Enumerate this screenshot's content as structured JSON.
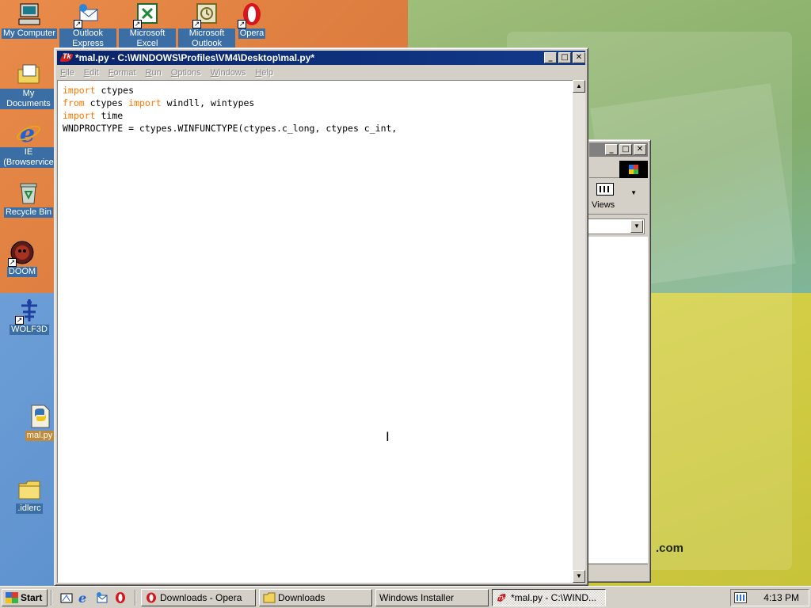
{
  "desktop": {
    "wallpaper_brand": ".com",
    "icons": [
      {
        "label": "My Computer",
        "icon": "computer-icon"
      },
      {
        "label": "Outlook Express",
        "icon": "outlook-express-icon"
      },
      {
        "label": "Microsoft Excel",
        "icon": "excel-icon"
      },
      {
        "label": "Microsoft Outlook",
        "icon": "outlook-icon"
      },
      {
        "label": "Opera",
        "icon": "opera-icon"
      },
      {
        "label": "My Documents",
        "icon": "documents-folder-icon"
      },
      {
        "label": "IE (Browservice",
        "icon": "internet-explorer-icon"
      },
      {
        "label": "Recycle Bin",
        "icon": "recycle-bin-icon"
      },
      {
        "label": "DOOM",
        "icon": "doom-icon"
      },
      {
        "label": "WOLF3D",
        "icon": "wolf3d-icon"
      },
      {
        "label": "mal.py",
        "icon": "python-file-icon"
      },
      {
        "label": ".idlerc",
        "icon": "folder-icon"
      }
    ]
  },
  "explorer_window": {
    "views_label": "Views"
  },
  "editor_window": {
    "title": "*mal.py - C:\\WINDOWS\\Profiles\\VM4\\Desktop\\mal.py*",
    "menu": [
      "File",
      "Edit",
      "Format",
      "Run",
      "Options",
      "Windows",
      "Help"
    ],
    "code_lines": [
      [
        {
          "text": "import",
          "kw": true
        },
        {
          "text": " ctypes",
          "kw": false
        }
      ],
      [
        {
          "text": "from",
          "kw": true
        },
        {
          "text": " ctypes ",
          "kw": false
        },
        {
          "text": "import",
          "kw": true
        },
        {
          "text": " windll, wintypes",
          "kw": false
        }
      ],
      [
        {
          "text": "import",
          "kw": true
        },
        {
          "text": " time",
          "kw": false
        }
      ],
      [
        {
          "text": "WNDPROCTYPE = ctypes.WINFUNCTYPE(ctypes.c_long, ctypes c_int,",
          "kw": false
        }
      ]
    ],
    "keyword_color": "#ff7700"
  },
  "taskbar": {
    "start_label": "Start",
    "quick_launch": [
      "show-desktop-icon",
      "internet-explorer-icon",
      "outlook-express-icon",
      "opera-icon"
    ],
    "tasks": [
      {
        "label": "Downloads - Opera",
        "icon": "opera-icon",
        "active": false
      },
      {
        "label": "Downloads",
        "icon": "folder-icon",
        "active": false
      },
      {
        "label": "Windows Installer",
        "icon": "",
        "active": false
      },
      {
        "label": "*mal.py - C:\\WIND...",
        "icon": "tk-icon",
        "active": true
      }
    ],
    "clock": "4:13 PM"
  },
  "colors": {
    "title_active": "#0a246a",
    "desktop_orange": "#e98b4a",
    "desktop_blue": "#4f86c8"
  }
}
